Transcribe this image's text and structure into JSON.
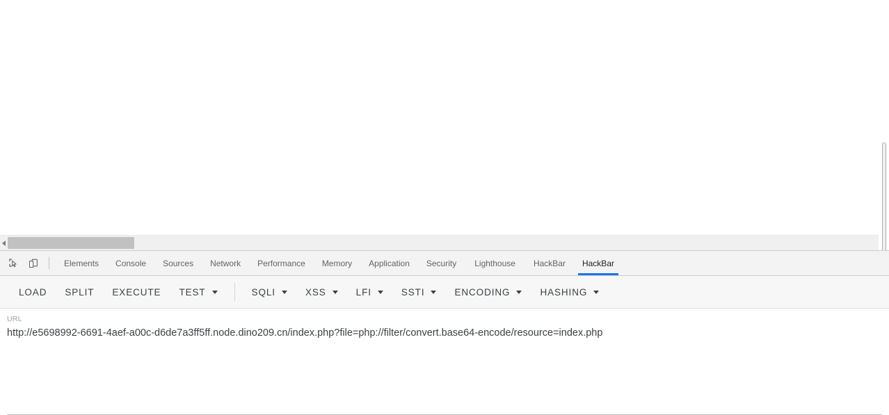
{
  "page": {
    "content": "",
    "scrollbars": {
      "vertical_present": true,
      "horizontal_present": true
    }
  },
  "devtools": {
    "icons": [
      {
        "name": "inspect-element-icon",
        "label": "Inspect element"
      },
      {
        "name": "device-toolbar-icon",
        "label": "Toggle device toolbar"
      }
    ],
    "tabs": [
      {
        "label": "Elements",
        "active": false
      },
      {
        "label": "Console",
        "active": false
      },
      {
        "label": "Sources",
        "active": false
      },
      {
        "label": "Network",
        "active": false
      },
      {
        "label": "Performance",
        "active": false
      },
      {
        "label": "Memory",
        "active": false
      },
      {
        "label": "Application",
        "active": false
      },
      {
        "label": "Security",
        "active": false
      },
      {
        "label": "Lighthouse",
        "active": false
      },
      {
        "label": "HackBar",
        "active": false
      },
      {
        "label": "HackBar",
        "active": true
      }
    ],
    "active_tab": "HackBar"
  },
  "hackbar": {
    "toolbar": {
      "actions": [
        {
          "label": "LOAD",
          "caret": false
        },
        {
          "label": "SPLIT",
          "caret": false
        },
        {
          "label": "EXECUTE",
          "caret": false
        },
        {
          "label": "TEST",
          "caret": true
        }
      ],
      "payloads": [
        {
          "label": "SQLI",
          "caret": true
        },
        {
          "label": "XSS",
          "caret": true
        },
        {
          "label": "LFI",
          "caret": true
        },
        {
          "label": "SSTI",
          "caret": true
        },
        {
          "label": "ENCODING",
          "caret": true
        },
        {
          "label": "HASHING",
          "caret": true
        }
      ]
    },
    "url_field": {
      "label": "URL",
      "value": "http://e5698992-6691-4aef-a00c-d6de7a3ff5ff.node.dino209.cn/index.php?file=php://filter/convert.base64-encode/resource=index.php",
      "placeholder": "URL"
    }
  },
  "colors": {
    "accent": "#1a73e8",
    "toolbar_bg": "#f7f7f7",
    "tabbar_bg": "#f3f3f3",
    "text": "#3c4043",
    "muted_text": "#5f6368",
    "label_text": "#9aa0a6",
    "scrollbar_thumb": "#c1c1c1"
  }
}
